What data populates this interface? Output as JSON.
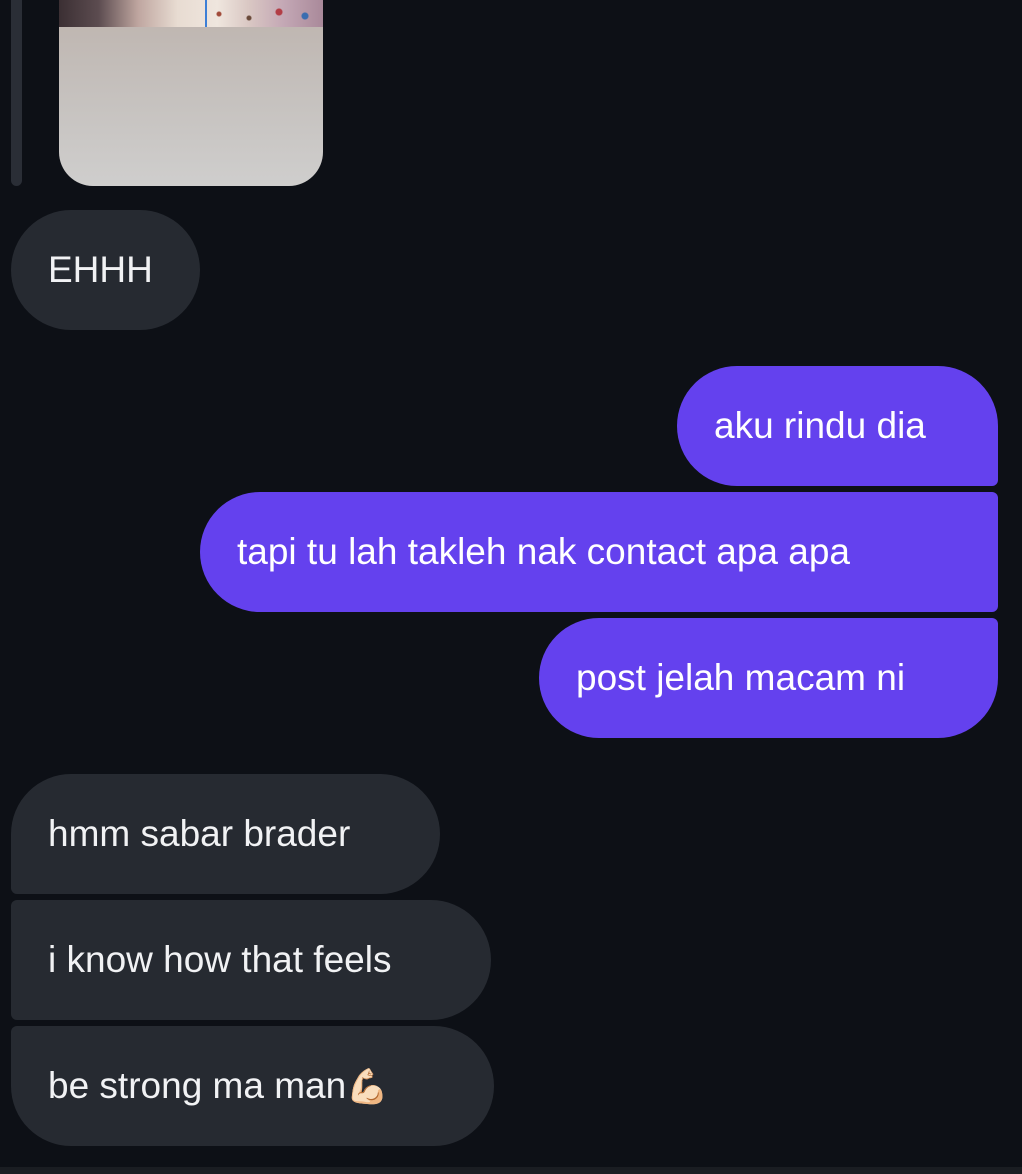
{
  "conversation": {
    "messages": [
      {
        "direction": "incoming",
        "text": "EHHH"
      },
      {
        "direction": "outgoing",
        "text": "aku rindu dia"
      },
      {
        "direction": "outgoing",
        "text": "tapi tu lah takleh nak contact apa apa"
      },
      {
        "direction": "outgoing",
        "text": "post jelah macam ni"
      },
      {
        "direction": "incoming",
        "text": "hmm sabar brader"
      },
      {
        "direction": "incoming",
        "text": "i know how that feels"
      },
      {
        "direction": "incoming",
        "text": "be strong ma man",
        "emoji": "💪🏻"
      }
    ]
  },
  "colors": {
    "background": "#0d1016",
    "incoming_bubble": "#262a31",
    "outgoing_bubble": "#6441ee",
    "text": "#ffffff"
  },
  "icons": [
    "flexed-biceps-emoji"
  ]
}
